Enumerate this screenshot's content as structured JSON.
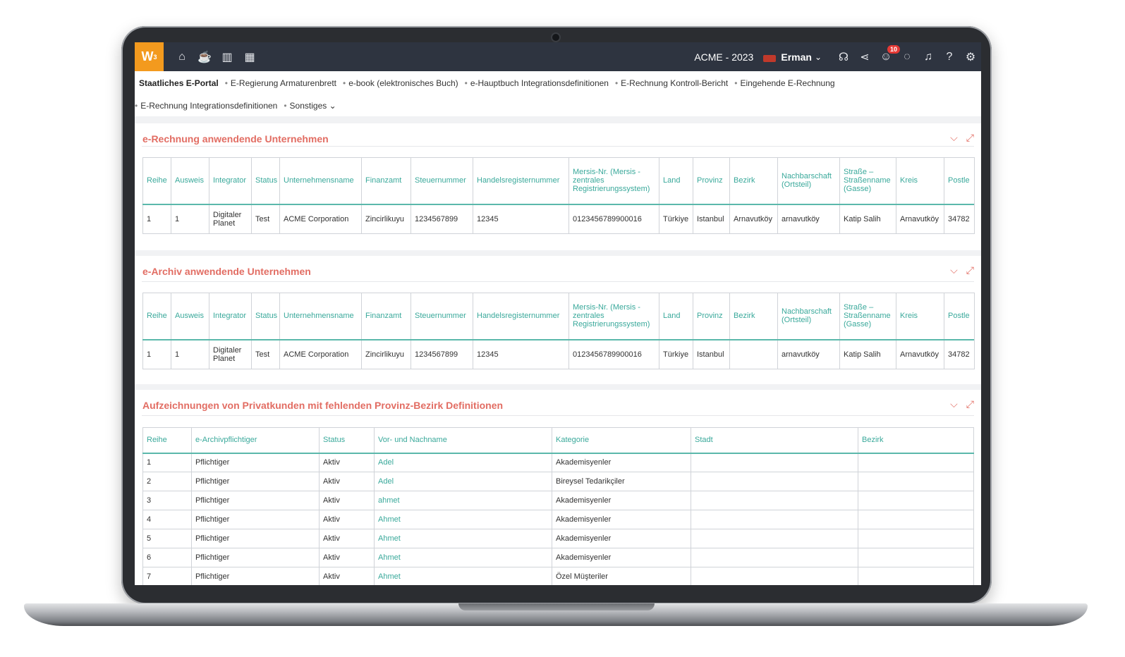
{
  "topbar": {
    "logo": "W",
    "logo_sup": "3",
    "nav_icons": [
      "home-icon",
      "coffee-icon",
      "chart-icon",
      "calendar-icon"
    ],
    "company": "ACME - 2023",
    "user": "Erman",
    "notification_count": "10"
  },
  "tabs": {
    "row1": [
      "Staatliches E-Portal",
      "E-Regierung Armaturenbrett",
      "e-book (elektronisches Buch)",
      "e-Hauptbuch Integrationsdefinitionen",
      "E-Rechnung Kontroll-Bericht",
      "Eingehende E-Rechnung"
    ],
    "row2": [
      "E-Rechnung Integrationsdefinitionen",
      "Sonstiges"
    ]
  },
  "panel1": {
    "title": "e-Rechnung anwendende Unternehmen",
    "headers": [
      "Reihe",
      "Ausweis",
      "Integrator",
      "Status",
      "Unternehmensname",
      "Finanzamt",
      "Steuernummer",
      "Handelsregisternummer",
      "Mersis-Nr. (Mersis - zentrales Registrierungssystem)",
      "Land",
      "Provinz",
      "Bezirk",
      "Nachbarschaft (Ortsteil)",
      "Straße – Straßenname (Gasse)",
      "Kreis",
      "Postle"
    ],
    "row": [
      "1",
      "1",
      "Digitaler Planet",
      "Test",
      "ACME Corporation",
      "Zincirlikuyu",
      "1234567899",
      "12345",
      "0123456789900016",
      "Türkiye",
      "Istanbul",
      "Arnavutköy",
      "arnavutköy",
      "Katip Salih",
      "Arnavutköy",
      "34782"
    ]
  },
  "panel2": {
    "title": "e-Archiv anwendende Unternehmen",
    "headers": [
      "Reihe",
      "Ausweis",
      "Integrator",
      "Status",
      "Unternehmensname",
      "Finanzamt",
      "Steuernummer",
      "Handelsregisternummer",
      "Mersis-Nr. (Mersis - zentrales Registrierungssystem)",
      "Land",
      "Provinz",
      "Bezirk",
      "Nachbarschaft (Ortsteil)",
      "Straße – Straßenname (Gasse)",
      "Kreis",
      "Postle"
    ],
    "row": [
      "1",
      "1",
      "Digitaler Planet",
      "Test",
      "ACME Corporation",
      "Zincirlikuyu",
      "1234567899",
      "12345",
      "0123456789900016",
      "Türkiye",
      "Istanbul",
      "",
      "arnavutköy",
      "Katip Salih",
      "Arnavutköy",
      "34782"
    ]
  },
  "panel3": {
    "title": "Aufzeichnungen von Privatkunden mit fehlenden Provinz-Bezirk Definitionen",
    "headers": [
      "Reihe",
      "e-Archivpflichtiger",
      "Status",
      "Vor- und Nachname",
      "Kategorie",
      "Stadt",
      "Bezirk"
    ],
    "rows": [
      [
        "1",
        "Pflichtiger",
        "Aktiv",
        "Adel",
        "Akademisyenler",
        "",
        ""
      ],
      [
        "2",
        "Pflichtiger",
        "Aktiv",
        "Adel",
        "Bireysel Tedarikçiler",
        "",
        ""
      ],
      [
        "3",
        "Pflichtiger",
        "Aktiv",
        "ahmet",
        "Akademisyenler",
        "",
        ""
      ],
      [
        "4",
        "Pflichtiger",
        "Aktiv",
        "Ahmet",
        "Akademisyenler",
        "",
        ""
      ],
      [
        "5",
        "Pflichtiger",
        "Aktiv",
        "Ahmet",
        "Akademisyenler",
        "",
        ""
      ],
      [
        "6",
        "Pflichtiger",
        "Aktiv",
        "Ahmet",
        "Akademisyenler",
        "",
        ""
      ],
      [
        "7",
        "Pflichtiger",
        "Aktiv",
        "Ahmet",
        "Özel Müşteriler",
        "",
        ""
      ]
    ]
  }
}
